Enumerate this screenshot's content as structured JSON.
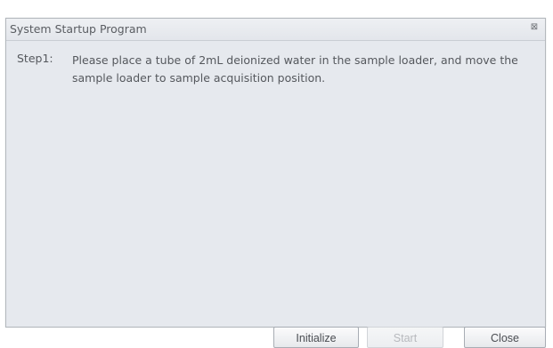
{
  "window": {
    "title": "System Startup Program",
    "close_icon": "close-icon"
  },
  "step": {
    "label": "Step1:",
    "instruction": "Please place a tube of 2mL deionized water in the sample loader, and move the sample loader to sample acquisition position."
  },
  "buttons": {
    "initialize": "Initialize",
    "start": "Start",
    "close": "Close"
  },
  "colors": {
    "dialog_bg": "#e6e9ee",
    "text": "#55585d",
    "disabled_text": "#b7b9bd"
  }
}
